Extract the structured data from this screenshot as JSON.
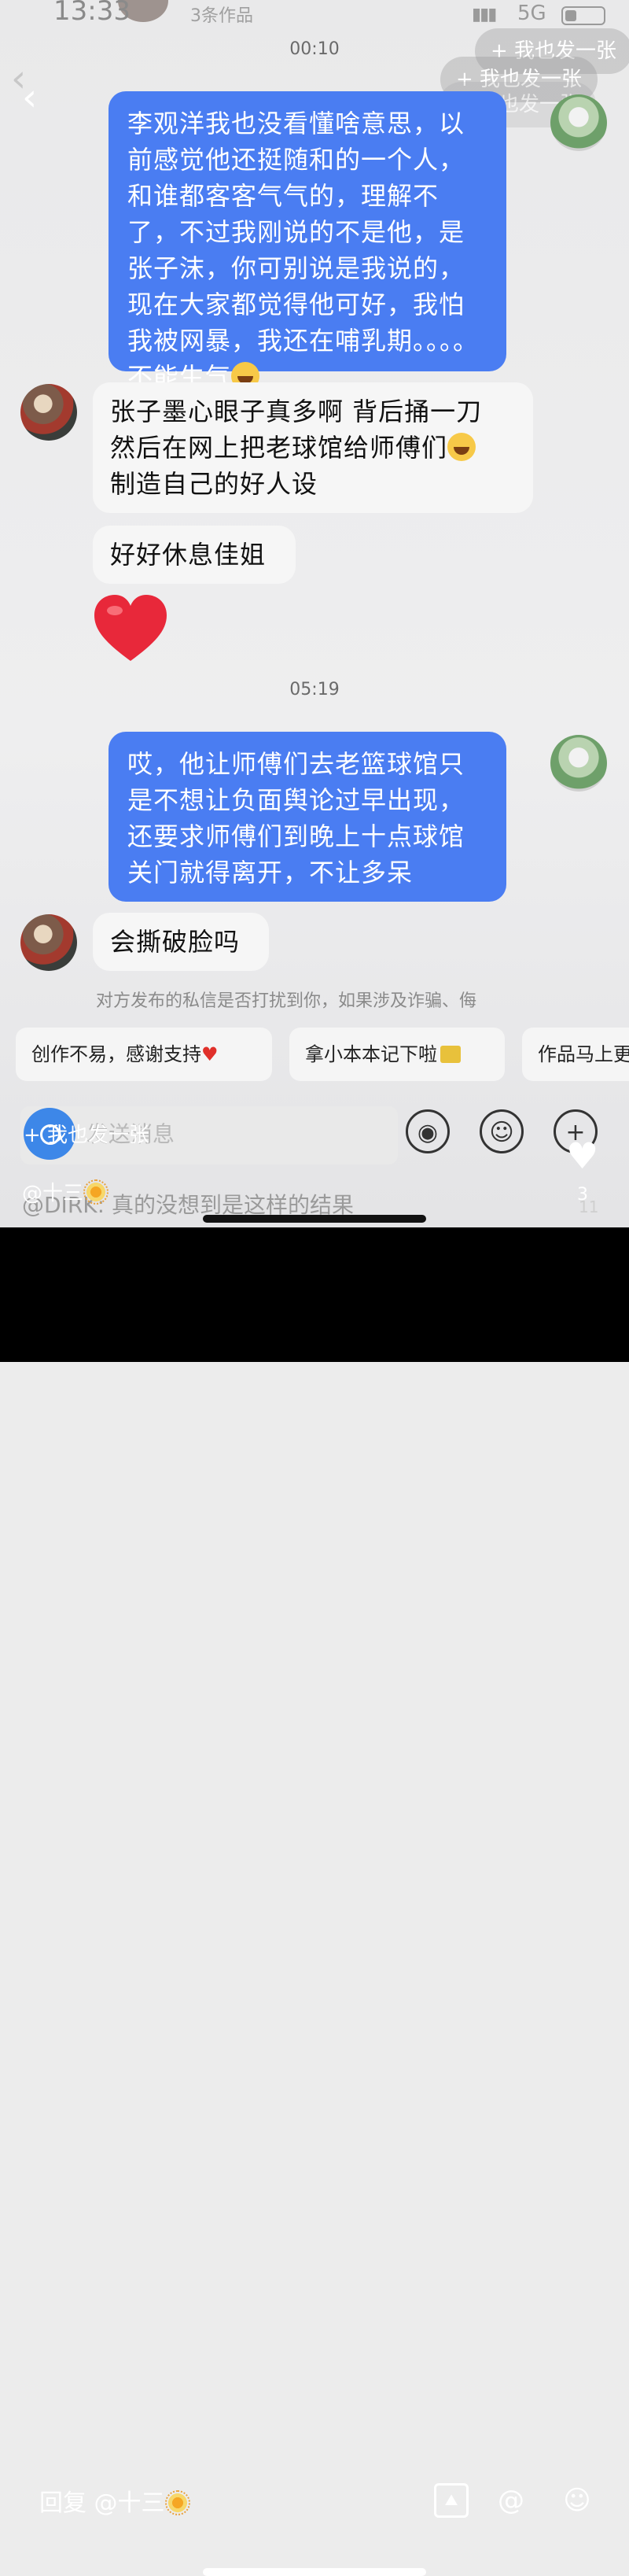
{
  "status": {
    "time": "13:33",
    "network": "5G",
    "works_count": "3条作品"
  },
  "actions": {
    "me_too": "+ 我也发一张"
  },
  "timestamps": [
    "00:10",
    "05:19"
  ],
  "messages": {
    "m1": "李观洋我也没看懂啥意思，以前感觉他还挺随和的一个人，和谁都客客气气的，理解不了，不过我刚说的不是他，是张子沫，你可别说是我说的，现在大家都觉得他可好，我怕我被网暴，我还在哺乳期。。。。不能生气",
    "m2a": "张子墨心眼子真多啊 背后捅一刀",
    "m2b": "然后在网上把老球馆给师傅们",
    "m2c": "制造自己的好人设",
    "m3": "好好休息佳姐",
    "m4": "哎，他让师傅们去老篮球馆只是不想让负面舆论过早出现，还要求师傅们到晚上十点球馆关门就得离开，不让多呆",
    "m5": "会撕破脸吗"
  },
  "notice": "对方发布的私信是否打扰到你，如果涉及诈骗、侮",
  "chips": [
    "创作不易，感谢支持",
    "拿小本本记下啦",
    "作品马上更"
  ],
  "input": {
    "placeholder": "发送消息"
  },
  "post": {
    "author": "@十三",
    "caption": "@DIRK: 真的没想到是这样的结果",
    "likes": "3",
    "badge": "11"
  },
  "comment": {
    "reply_prompt": "回复 @十三"
  },
  "icons": [
    "back-icon",
    "voice-icon",
    "emoji-icon",
    "plus-icon",
    "heart-icon",
    "image-icon",
    "at-icon",
    "smiley-icon"
  ]
}
